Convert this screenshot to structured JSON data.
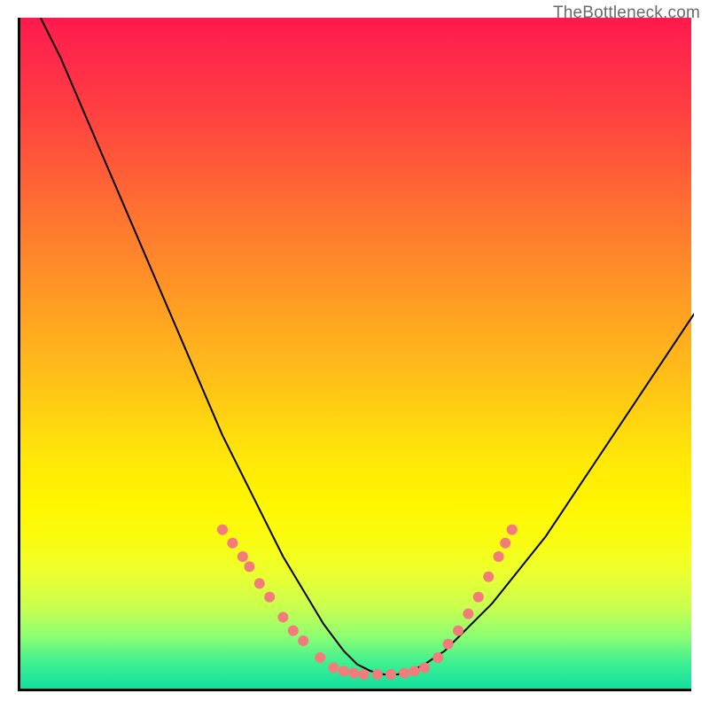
{
  "watermark": "TheBottleneck.com",
  "chart_data": {
    "type": "line",
    "title": "",
    "xlabel": "",
    "ylabel": "",
    "xlim": [
      0,
      100
    ],
    "ylim": [
      0,
      100
    ],
    "axes_visible": {
      "ticks": false,
      "grid": false,
      "left_border": true,
      "bottom_border": true
    },
    "background_gradient": {
      "direction": "top_to_bottom",
      "stops": [
        {
          "pos": 0,
          "color": "#ff1a4d"
        },
        {
          "pos": 50,
          "color": "#ffc018"
        },
        {
          "pos": 72,
          "color": "#fff500"
        },
        {
          "pos": 100,
          "color": "#10e0a0"
        }
      ]
    },
    "series": [
      {
        "name": "curve",
        "style": {
          "stroke": "#000000",
          "width": 2,
          "fill": "none"
        },
        "x": [
          3,
          6,
          9,
          12,
          15,
          18,
          21,
          24,
          27,
          30,
          33,
          36,
          39,
          42,
          45,
          48,
          50,
          52,
          54,
          56,
          58,
          60,
          63,
          66,
          70,
          74,
          78,
          82,
          86,
          90,
          94,
          98,
          100
        ],
        "y": [
          100,
          94,
          87,
          80,
          73,
          66,
          59,
          52,
          45,
          38,
          32,
          26,
          20,
          15,
          10,
          6,
          4,
          3,
          2.5,
          2.5,
          3,
          4,
          6,
          9,
          13,
          18,
          23,
          29,
          35,
          41,
          47,
          53,
          56
        ]
      },
      {
        "name": "beads_left_slope",
        "style": {
          "marker": "circle",
          "radius": 6,
          "fill": "#f37b7b",
          "stroke": "none"
        },
        "x": [
          30,
          31.5,
          33,
          34,
          35.5,
          37,
          39,
          40.5,
          42,
          44.5,
          46.5
        ],
        "y": [
          24,
          22,
          20,
          18.5,
          16,
          14,
          11,
          9,
          7.5,
          5,
          3.5
        ]
      },
      {
        "name": "beads_valley_floor",
        "style": {
          "marker": "circle",
          "radius": 6,
          "fill": "#f37b7b",
          "stroke": "none"
        },
        "x": [
          48,
          49.5,
          51,
          53,
          55,
          57,
          58.5,
          60
        ],
        "y": [
          3,
          2.7,
          2.5,
          2.5,
          2.5,
          2.7,
          3,
          3.5
        ]
      },
      {
        "name": "beads_right_slope",
        "style": {
          "marker": "circle",
          "radius": 6,
          "fill": "#f37b7b",
          "stroke": "none"
        },
        "x": [
          62,
          63.5,
          65,
          66.5,
          68,
          69.5,
          71,
          72,
          73
        ],
        "y": [
          5,
          7,
          9,
          11.5,
          14,
          17,
          20,
          22,
          24
        ]
      }
    ]
  }
}
